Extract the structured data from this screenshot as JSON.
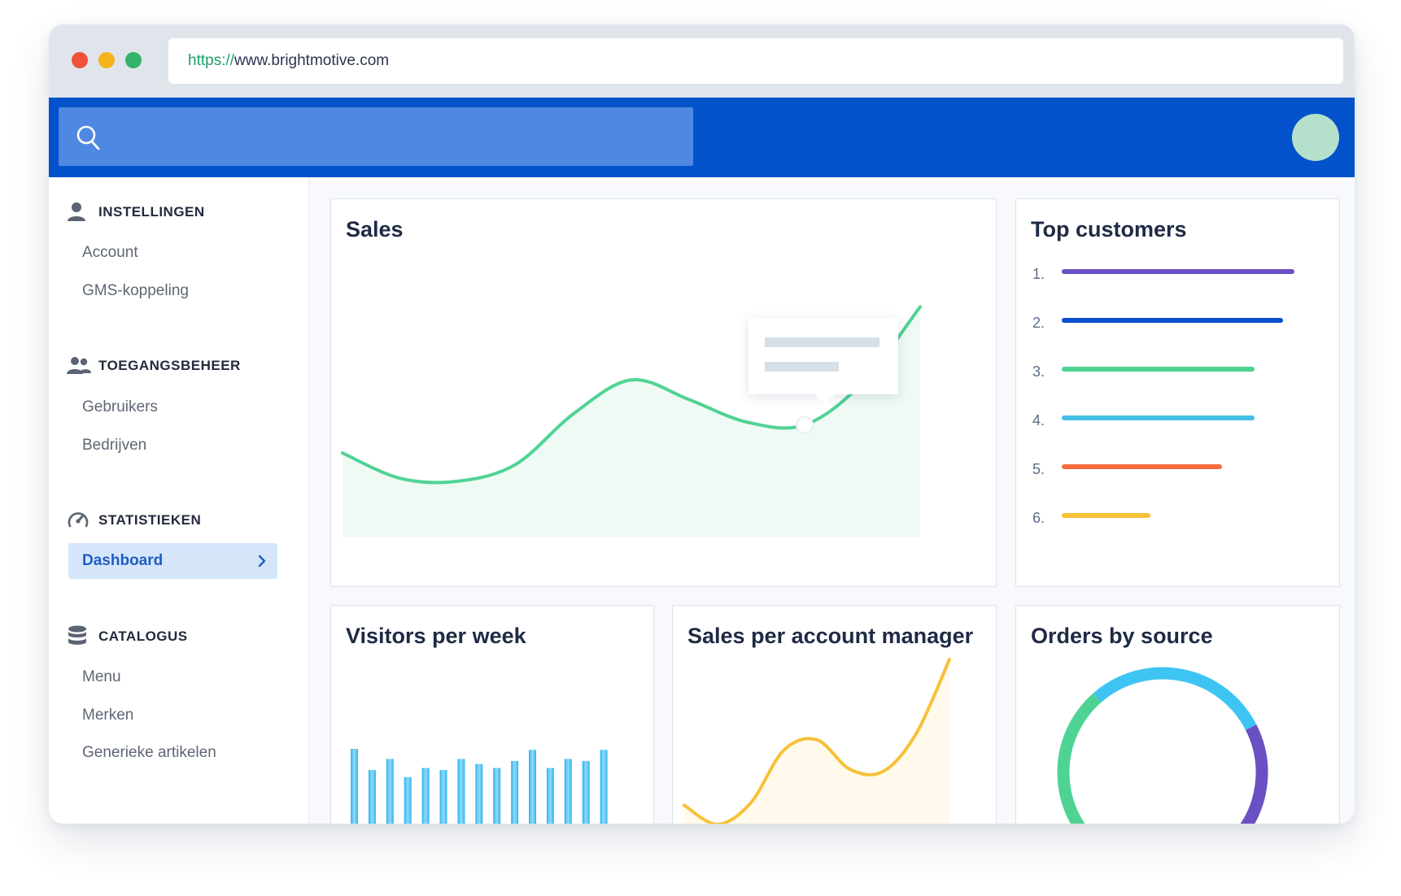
{
  "browser": {
    "url_scheme": "https://",
    "url_host": "www.brightmotive.com"
  },
  "header": {
    "search_icon": "search-icon",
    "search_placeholder": ""
  },
  "sidebar": {
    "sections": [
      {
        "title": "INSTELLINGEN",
        "icon": "user-icon",
        "items": [
          "Account",
          "GMS-koppeling"
        ]
      },
      {
        "title": "TOEGANGSBEHEER",
        "icon": "users-icon",
        "items": [
          "Gebruikers",
          "Bedrijven"
        ]
      },
      {
        "title": "STATISTIEKEN",
        "icon": "speedometer-icon",
        "items": [
          "Dashboard"
        ]
      },
      {
        "title": "CATALOGUS",
        "icon": "database-icon",
        "items": [
          "Menu",
          "Merken",
          "Generieke artikelen"
        ]
      }
    ],
    "active_item": "Dashboard"
  },
  "cards": {
    "sales": {
      "title": "Sales"
    },
    "top_customers": {
      "title": "Top customers"
    },
    "visitors": {
      "title": "Visitors per week"
    },
    "account_manager": {
      "title": "Sales per account manager"
    },
    "orders": {
      "title": "Orders by source"
    }
  },
  "colors": {
    "brand_blue": "#0352cc",
    "sales_line": "#4fd394",
    "account_line": "#f7c137",
    "bar_blue": "#3ec4f3"
  },
  "chart_data": [
    {
      "type": "area",
      "title": "Sales",
      "x": [
        0,
        1,
        2,
        3,
        4,
        5,
        6,
        7,
        8,
        9,
        10
      ],
      "values": [
        30,
        21,
        20,
        26,
        44,
        56,
        49,
        41,
        40,
        55,
        82
      ],
      "ylim": [
        0,
        100
      ],
      "highlight_index": 8
    },
    {
      "type": "bar",
      "title": "Top customers",
      "categories": [
        "1.",
        "2.",
        "3.",
        "4.",
        "5.",
        "6."
      ],
      "values": [
        100,
        95,
        83,
        83,
        69,
        38
      ],
      "colors": [
        "#6a50c2",
        "#0a4fcc",
        "#4fd394",
        "#45bfe6",
        "#f56c3d",
        "#f7c137"
      ]
    },
    {
      "type": "bar",
      "title": "Visitors per week",
      "categories": [
        "1",
        "2",
        "3",
        "4",
        "5",
        "6",
        "7",
        "8",
        "9",
        "10",
        "11",
        "12",
        "13",
        "14",
        "15"
      ],
      "values": [
        100,
        79,
        90,
        72,
        81,
        79,
        90,
        85,
        81,
        88,
        99,
        81,
        90,
        88,
        99
      ],
      "ylim": [
        0,
        100
      ]
    },
    {
      "type": "area",
      "title": "Sales per account manager",
      "x": [
        0,
        1,
        2,
        3,
        4,
        5,
        6,
        7,
        8
      ],
      "values": [
        21,
        12,
        22,
        47,
        52,
        38,
        37,
        55,
        90
      ],
      "ylim": [
        0,
        100
      ]
    },
    {
      "type": "pie",
      "title": "Orders by source",
      "series": [
        {
          "color": "#3ec4f3",
          "value": 22
        },
        {
          "color": "#6a50c2",
          "value": 28
        },
        {
          "color": "#0a4fcc",
          "value": 4
        },
        {
          "color": "#4fd394",
          "value": 22
        }
      ]
    }
  ]
}
